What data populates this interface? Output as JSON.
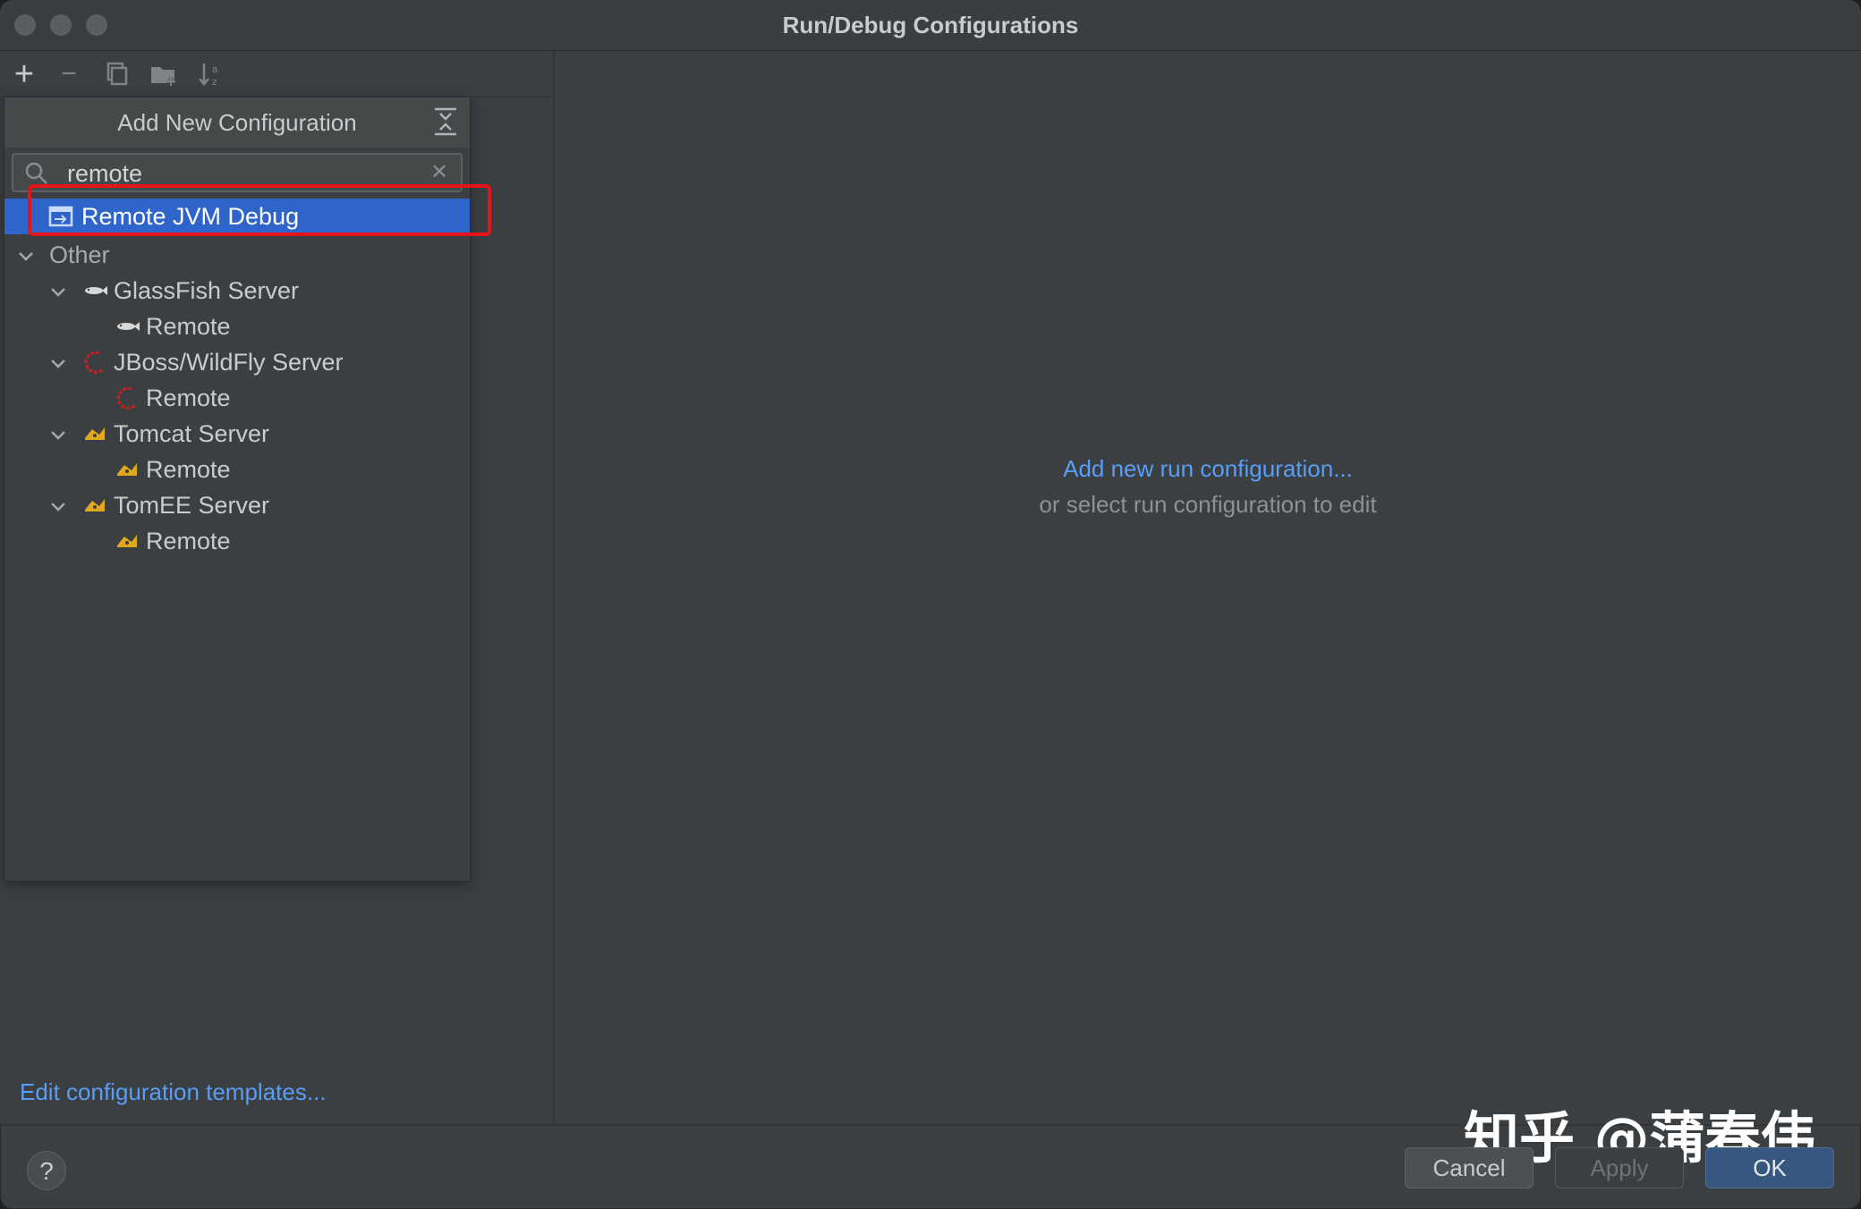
{
  "window": {
    "title": "Run/Debug Configurations"
  },
  "toolbar": {
    "icons": [
      "add-icon",
      "remove-icon",
      "copy-icon",
      "folder-icon",
      "sort-icon"
    ]
  },
  "popup": {
    "title": "Add New Configuration",
    "search_value": "remote",
    "selected_item": "Remote JVM Debug",
    "group_label": "Other",
    "servers": [
      {
        "label": "GlassFish Server",
        "child": "Remote",
        "icon": "glassfish-icon"
      },
      {
        "label": "JBoss/WildFly Server",
        "child": "Remote",
        "icon": "jboss-icon"
      },
      {
        "label": "Tomcat Server",
        "child": "Remote",
        "icon": "tomcat-icon"
      },
      {
        "label": "TomEE Server",
        "child": "Remote",
        "icon": "tomee-icon"
      }
    ]
  },
  "main": {
    "add_link": "Add new run configuration...",
    "hint": "or select run configuration to edit"
  },
  "footer": {
    "templates_link": "Edit configuration templates...",
    "help_label": "?",
    "cancel_label": "Cancel",
    "apply_label": "Apply",
    "ok_label": "OK"
  },
  "watermark": "知乎 @蒲春伟",
  "colors": {
    "accent": "#2f65ca",
    "link": "#589df6",
    "highlight": "#e3151b"
  }
}
